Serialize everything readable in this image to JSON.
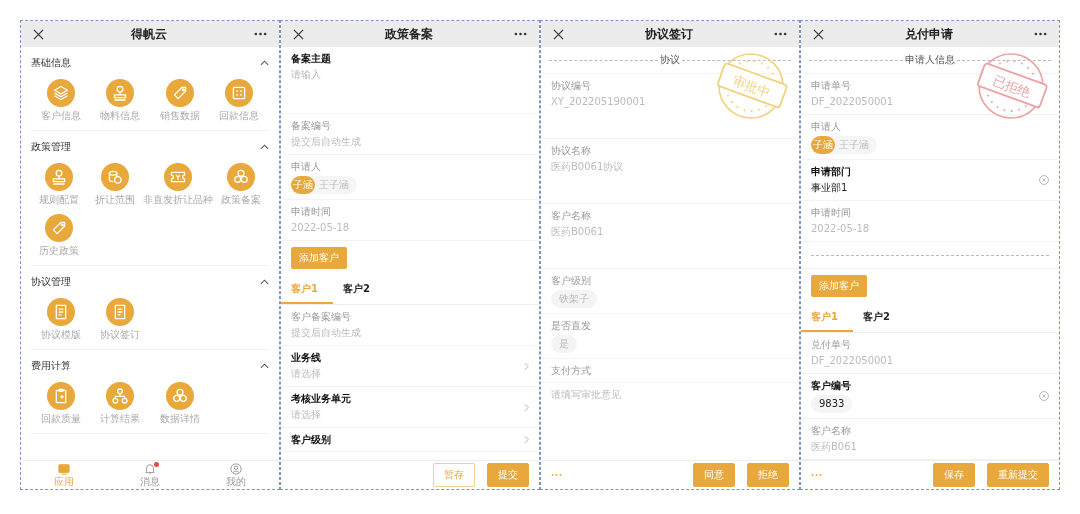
{
  "phones": [
    {
      "kind": "launcher",
      "title": "得帆云",
      "sections": [
        {
          "title": "基础信息",
          "expanded": true,
          "apps": [
            "客户信息",
            "物料信息",
            "销售数据",
            "回款信息"
          ]
        },
        {
          "title": "政策管理",
          "expanded": true,
          "apps": [
            "规则配置",
            "折让范围",
            "非直发折让品种",
            "政策备案",
            "历史政策"
          ]
        },
        {
          "title": "协议管理",
          "expanded": true,
          "apps": [
            "协议模版",
            "协议签订"
          ]
        },
        {
          "title": "费用计算",
          "expanded": true,
          "apps": [
            "回款质量",
            "计算结果",
            "数据详情"
          ]
        }
      ],
      "tabbar": [
        {
          "label": "应用",
          "selected": true,
          "badge": false
        },
        {
          "label": "消息",
          "selected": false,
          "badge": true
        },
        {
          "label": "我的",
          "selected": false,
          "badge": false
        }
      ]
    },
    {
      "kind": "form",
      "title": "政策备案",
      "items": [
        {
          "kind": "textarea",
          "label": "备案主题",
          "editable": true,
          "placeholder": "请输入"
        },
        {
          "kind": "field",
          "label": "备案编号",
          "editable": false,
          "value": "提交后自动生成"
        },
        {
          "kind": "person",
          "label": "申请人",
          "editable": false,
          "avatar": "子涵",
          "name": "王子涵"
        },
        {
          "kind": "field",
          "label": "申请时间",
          "editable": false,
          "value": "2022-05-18"
        },
        {
          "kind": "button",
          "label": "添加客户"
        },
        {
          "kind": "tabs",
          "tabs": [
            {
              "label": "客户1",
              "selected": true
            },
            {
              "label": "客户2",
              "selected": false
            }
          ]
        },
        {
          "kind": "field",
          "label": "客户备案编号",
          "editable": false,
          "value": "提交后自动生成"
        },
        {
          "kind": "select",
          "label": "业务线",
          "editable": true,
          "placeholder": "请选择"
        },
        {
          "kind": "select",
          "label": "考核业务单元",
          "editable": true,
          "placeholder": "请选择"
        },
        {
          "kind": "select",
          "label": "客户级别",
          "editable": true
        }
      ],
      "footer": {
        "buttons": [
          {
            "label": "暂存",
            "primary": false
          },
          {
            "label": "提交",
            "primary": true
          }
        ]
      }
    },
    {
      "kind": "form",
      "title": "协议签订",
      "stamp": {
        "text": "审批中",
        "color": "#f2d27e"
      },
      "items": [
        {
          "kind": "divider",
          "text": "协议"
        },
        {
          "kind": "textarea",
          "label": "协议编号",
          "editable": false,
          "value": "XY_202205190001"
        },
        {
          "kind": "textarea",
          "label": "协议名称",
          "editable": false,
          "value": "医药B0061协议"
        },
        {
          "kind": "textarea",
          "label": "客户名称",
          "editable": false,
          "value": "医药B0061"
        },
        {
          "kind": "chip",
          "label": "客户级别",
          "editable": false,
          "value": "铁架子"
        },
        {
          "kind": "chip",
          "label": "是否直发",
          "editable": false,
          "value": "是"
        },
        {
          "kind": "field",
          "label": "支付方式",
          "editable": false
        },
        {
          "kind": "textarea",
          "placeholder": "请填写审批意见"
        }
      ],
      "footer": {
        "more": true,
        "buttons": [
          {
            "label": "同意",
            "primary": true
          },
          {
            "label": "拒绝",
            "primary": true
          }
        ]
      }
    },
    {
      "kind": "form",
      "title": "兑付申请",
      "stamp": {
        "text": "已拒绝",
        "color": "#eba3a3"
      },
      "items": [
        {
          "kind": "divider",
          "text": "申请人信息"
        },
        {
          "kind": "field",
          "label": "申请单号",
          "editable": false,
          "value": "DF_2022050001"
        },
        {
          "kind": "person",
          "label": "申请人",
          "editable": false,
          "avatar": "子涵",
          "name": "王子涵"
        },
        {
          "kind": "field",
          "label": "申请部门",
          "editable": true,
          "value": "事业部1",
          "clearable": true
        },
        {
          "kind": "field",
          "label": "申请时间",
          "editable": false,
          "value": "2022-05-18"
        },
        {
          "kind": "rule"
        },
        {
          "kind": "button",
          "label": "添加客户"
        },
        {
          "kind": "tabs",
          "tabs": [
            {
              "label": "客户1",
              "selected": true
            },
            {
              "label": "客户2",
              "selected": false
            }
          ]
        },
        {
          "kind": "field",
          "label": "兑付单号",
          "editable": false,
          "value": "DF_2022050001"
        },
        {
          "kind": "chip",
          "label": "客户编号",
          "editable": true,
          "value": "9833",
          "clearable": true
        },
        {
          "kind": "field",
          "label": "客户名称",
          "editable": false,
          "value": "医药B061"
        }
      ],
      "footer": {
        "more": true,
        "buttons": [
          {
            "label": "保存",
            "primary": true
          },
          {
            "label": "重新提交",
            "primary": true
          }
        ]
      }
    }
  ]
}
